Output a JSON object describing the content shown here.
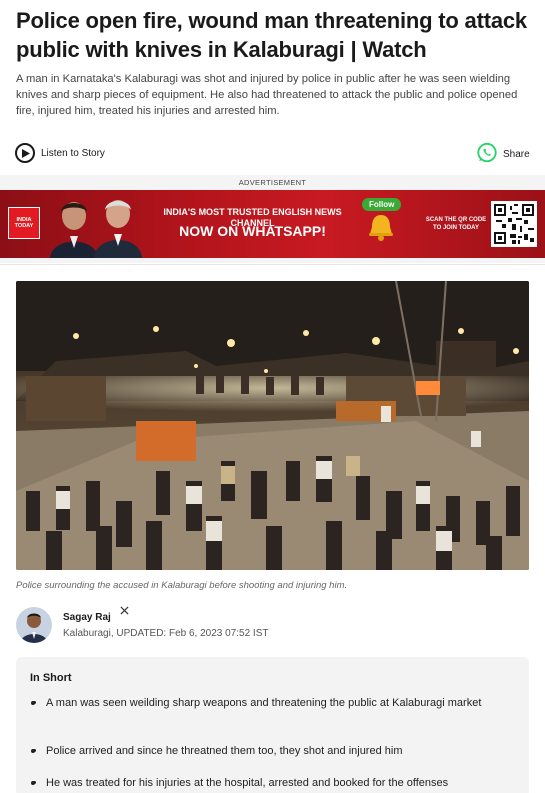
{
  "article": {
    "headline": "Police open fire, wound man threatening to attack public with knives in Kalaburagi | Watch",
    "summary": "A man in Karnataka's Kalaburagi was shot and injured by police in public after he was seen wielding knives and sharp pieces of equipment. He also had threatened to attack the public and police opened fire, injured him, treated his injuries and arrested him."
  },
  "actions": {
    "listen_label": "Listen to Story",
    "share_label": "Share"
  },
  "ad": {
    "label": "ADVERTISEMENT",
    "logo_line1": "INDIA",
    "logo_line2": "TODAY",
    "tagline": "INDIA'S MOST TRUSTED ENGLISH NEWS CHANNEL",
    "cta": "NOW ON WHATSAPP!",
    "follow_label": "Follow",
    "scan_text": "SCAN THE QR CODE TO JOIN TODAY"
  },
  "media": {
    "caption": "Police surrounding the accused in Kalaburagi before shooting and injuring him."
  },
  "byline": {
    "author": "Sagay Raj",
    "social_icon": "x-icon",
    "dateline": "Kalaburagi, UPDATED: Feb 6, 2023 07:52 IST"
  },
  "in_short": {
    "title": "In Short",
    "items": [
      "A man was seen weilding sharp weapons and threatening the public at Kalaburagi market",
      "Police arrived and since he threatned them too, they shot and injured him",
      "He was treated for his injuries at the hospital, arrested and booked for the offenses"
    ]
  },
  "colors": {
    "banner_red": "#b3141c",
    "whatsapp_green": "#25d366",
    "follow_green": "#3aaa35"
  }
}
